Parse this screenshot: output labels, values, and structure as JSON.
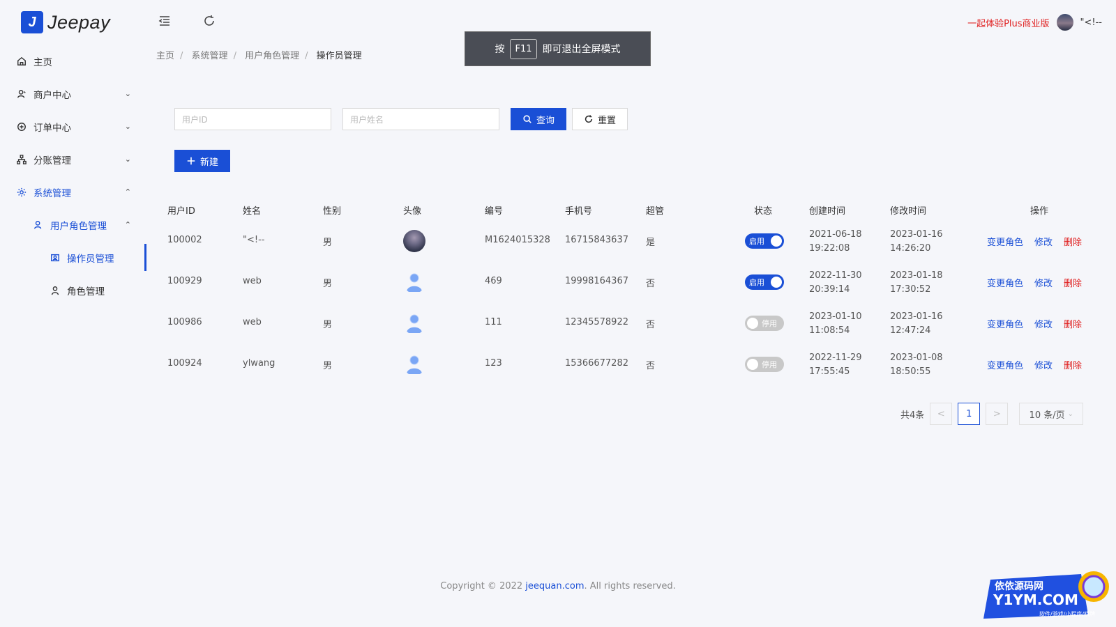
{
  "brand": {
    "logo_mark": "J",
    "name": "Jeepay"
  },
  "sidebar": {
    "items": [
      {
        "label": "主页",
        "icon": "home-icon"
      },
      {
        "label": "商户中心",
        "icon": "merchant-icon"
      },
      {
        "label": "订单中心",
        "icon": "order-icon"
      },
      {
        "label": "分账管理",
        "icon": "split-icon"
      },
      {
        "label": "系统管理",
        "icon": "gear-icon"
      },
      {
        "label": "用户角色管理",
        "icon": "users-icon"
      },
      {
        "label": "操作员管理",
        "icon": "operator-icon"
      },
      {
        "label": "角色管理",
        "icon": "role-icon"
      }
    ]
  },
  "header": {
    "promo": "一起体验Plus商业版",
    "user_name": "\"<!--"
  },
  "toast": {
    "prefix": "按",
    "key": "F11",
    "suffix": "即可退出全屏模式"
  },
  "breadcrumb": [
    "主页",
    "系统管理",
    "用户角色管理",
    "操作员管理"
  ],
  "filter": {
    "user_id_placeholder": "用户ID",
    "user_name_placeholder": "用户姓名",
    "search_label": "查询",
    "reset_label": "重置",
    "new_label": "新建"
  },
  "table": {
    "headers": [
      "用户ID",
      "姓名",
      "性别",
      "头像",
      "编号",
      "手机号",
      "超管",
      "状态",
      "创建时间",
      "修改时间",
      "操作"
    ],
    "rows": [
      {
        "id": "100002",
        "name": "\"<!--",
        "gender": "男",
        "avatar": "photo",
        "no": "M1624015328",
        "phone": "16715843637",
        "super": "是",
        "status": "启用",
        "status_on": true,
        "created_date": "2021-06-18",
        "created_time": "19:22:08",
        "modified_date": "2023-01-16",
        "modified_time": "14:26:20"
      },
      {
        "id": "100929",
        "name": "web",
        "gender": "男",
        "avatar": "default",
        "no": "469",
        "phone": "19998164367",
        "super": "否",
        "status": "启用",
        "status_on": true,
        "created_date": "2022-11-30",
        "created_time": "20:39:14",
        "modified_date": "2023-01-18",
        "modified_time": "17:30:52"
      },
      {
        "id": "100986",
        "name": "web",
        "gender": "男",
        "avatar": "default",
        "no": "111",
        "phone": "12345578922",
        "super": "否",
        "status": "停用",
        "status_on": false,
        "created_date": "2023-01-10",
        "created_time": "11:08:54",
        "modified_date": "2023-01-16",
        "modified_time": "12:47:24"
      },
      {
        "id": "100924",
        "name": "ylwang",
        "gender": "男",
        "avatar": "default",
        "no": "123",
        "phone": "15366677282",
        "super": "否",
        "status": "停用",
        "status_on": false,
        "created_date": "2022-11-29",
        "created_time": "17:55:45",
        "modified_date": "2023-01-08",
        "modified_time": "18:50:55"
      }
    ],
    "ops": {
      "change_role": "变更角色",
      "edit": "修改",
      "delete": "删除"
    }
  },
  "pagination": {
    "total": "共4条",
    "prev": "<",
    "current": "1",
    "next": ">",
    "size": "10 条/页"
  },
  "footer": {
    "prefix": "Copyright © 2022 ",
    "link": "jeequan.com",
    "suffix": ". All rights reserved."
  },
  "watermark": {
    "line1": "依依源码网",
    "line2": "Y1YM.COM",
    "line3": "软件/游戏/小程序/棋牌"
  },
  "colors": {
    "primary": "#1a4fd6",
    "danger": "#e02020",
    "bg": "#f5f6fa"
  }
}
